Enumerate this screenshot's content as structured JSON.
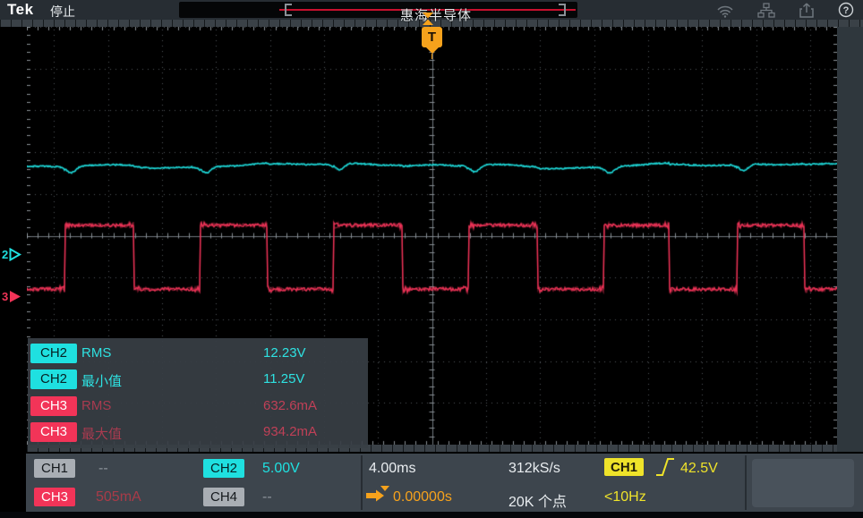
{
  "header": {
    "brand": "Tek",
    "acq_status": "停止",
    "watermark": "惠海半导体",
    "icons": [
      "wifi-icon",
      "network-icon",
      "file-save-icon",
      "help-icon"
    ]
  },
  "markers": {
    "ch2_number": "2",
    "ch3_number": "3",
    "trigger_symbol": "T"
  },
  "measurements": {
    "rows": [
      {
        "channel": "CH2",
        "label": "RMS",
        "value": "12.23V"
      },
      {
        "channel": "CH2",
        "label": "最小值",
        "value": "11.25V"
      },
      {
        "channel": "CH3",
        "label": "RMS",
        "value": "632.6mA"
      },
      {
        "channel": "CH3",
        "label": "最大值",
        "value": "934.2mA"
      }
    ]
  },
  "statusbar": {
    "channels": [
      {
        "name": "CH1",
        "value": "--",
        "type": "off"
      },
      {
        "name": "CH2",
        "value": "5.00V",
        "type": "cyan"
      },
      {
        "name": "CH3",
        "value": "505mA",
        "type": "red"
      },
      {
        "name": "CH4",
        "value": "--",
        "type": "off"
      }
    ],
    "timebase": "4.00ms",
    "sample_rate": "312kS/s",
    "horizontal_position": "0.00000s",
    "record_length": "20K 个点",
    "trigger": {
      "source": "CH1",
      "slope": "rising",
      "level": "42.5V",
      "frequency": "<10Hz"
    }
  },
  "colors": {
    "cyan": "#1fe0e0",
    "red": "#f23458",
    "yellow": "#efe32a",
    "orange": "#f6a21c"
  },
  "chart_data": {
    "type": "line",
    "title": "",
    "x_axis": {
      "units": "ms",
      "seconds_per_div": "4.00ms",
      "divisions": 15,
      "range_ms": [
        -30,
        30
      ],
      "trigger_position_ms": 0
    },
    "y_axis": {
      "divisions": 10,
      "grid": "dotted"
    },
    "legend_position": "none",
    "ref_markers_div_from_top": {
      "CH2": 5.46,
      "CH3": 6.47
    },
    "series": [
      {
        "name": "CH2",
        "kind": "dc_with_ripple",
        "color": "#1fe0e0",
        "volts_per_div": 5.0,
        "displayed_level_div_above_ref": 2.13,
        "rms_V": 12.23,
        "min_V": 11.25,
        "dip_at_ch3_rising_edges_div": 0.16
      },
      {
        "name": "CH3",
        "kind": "square",
        "color": "#f23458",
        "milliamps_per_div": 505,
        "high_div_above_ref": 1.72,
        "low_div_above_ref": 0.19,
        "high_mA": 869,
        "low_mA": 96,
        "rise_times_ms": [
          -27.2,
          -17.2,
          -7.3,
          2.7,
          12.7,
          22.6
        ],
        "fall_times_ms": [
          -22.1,
          -12.2,
          -2.2,
          7.8,
          17.6,
          27.6
        ],
        "rms_mA": 632.6,
        "max_mA": 934.2
      }
    ]
  }
}
